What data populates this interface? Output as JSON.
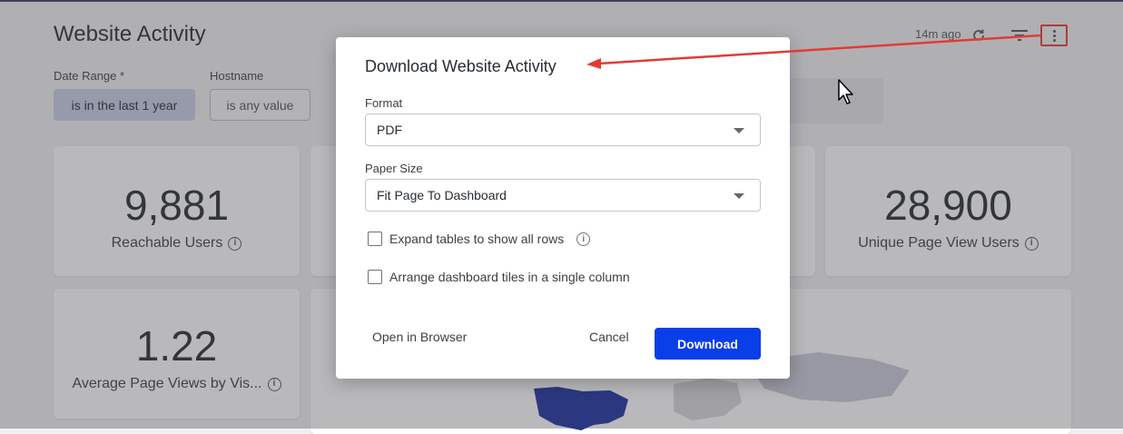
{
  "dashboard": {
    "title": "Website Activity",
    "updated": "14m ago",
    "filters": [
      {
        "label": "Date Range *",
        "value": "is in the last 1 year"
      },
      {
        "label": "Hostname",
        "value": "is any value"
      }
    ],
    "tiles": [
      {
        "value": "9,881",
        "label": "Reachable Users"
      },
      {
        "value": "28,900",
        "label": "Unique Page View Users"
      },
      {
        "value": "1.22",
        "label": "Average Page Views by Vis..."
      }
    ]
  },
  "modal": {
    "title": "Download Website Activity",
    "format_label": "Format",
    "format_value": "PDF",
    "paper_label": "Paper Size",
    "paper_value": "Fit Page To Dashboard",
    "expand_tables": "Expand tables to show all rows",
    "single_column": "Arrange dashboard tiles in a single column",
    "open_browser": "Open in Browser",
    "cancel": "Cancel",
    "download": "Download"
  },
  "annotation": {
    "color": "#e53935"
  }
}
